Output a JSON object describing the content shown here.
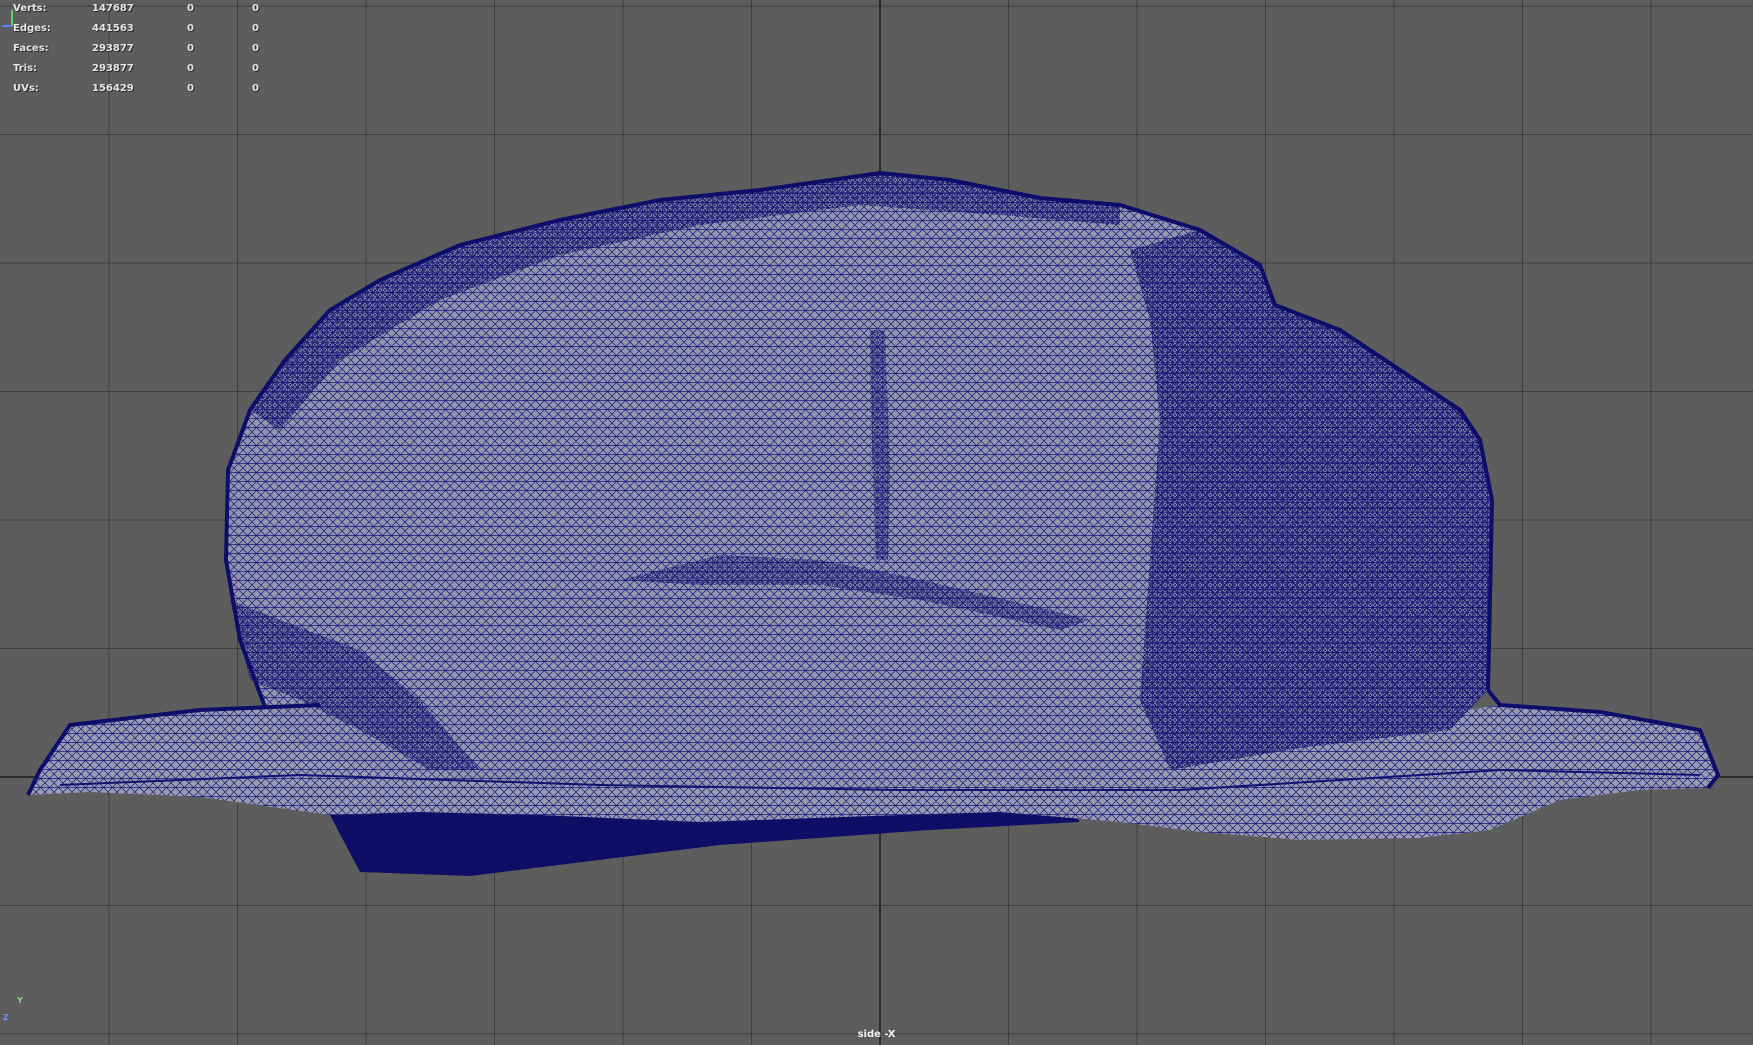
{
  "hud": {
    "rows": [
      {
        "label": "Verts:",
        "value": "147687",
        "selected": "0",
        "component": "0"
      },
      {
        "label": "Edges:",
        "value": "441563",
        "selected": "0",
        "component": "0"
      },
      {
        "label": "Faces:",
        "value": "293877",
        "selected": "0",
        "component": "0"
      },
      {
        "label": "Tris:",
        "value": "293877",
        "selected": "0",
        "component": "0"
      },
      {
        "label": "UVs:",
        "value": "156429",
        "selected": "0",
        "component": "0"
      }
    ]
  },
  "viewport": {
    "camera_label": "side -X",
    "background_color": "#5d5d5d",
    "grid_color": "#3f3f3f",
    "axis_line_color": "#2b2b2b",
    "mesh_fill_color": "#8f8fa6",
    "wire_color": "#13137a"
  },
  "axis_gizmo": {
    "y_label": "Y",
    "z_label": "Z",
    "icon": "axis-gizmo-icon"
  }
}
